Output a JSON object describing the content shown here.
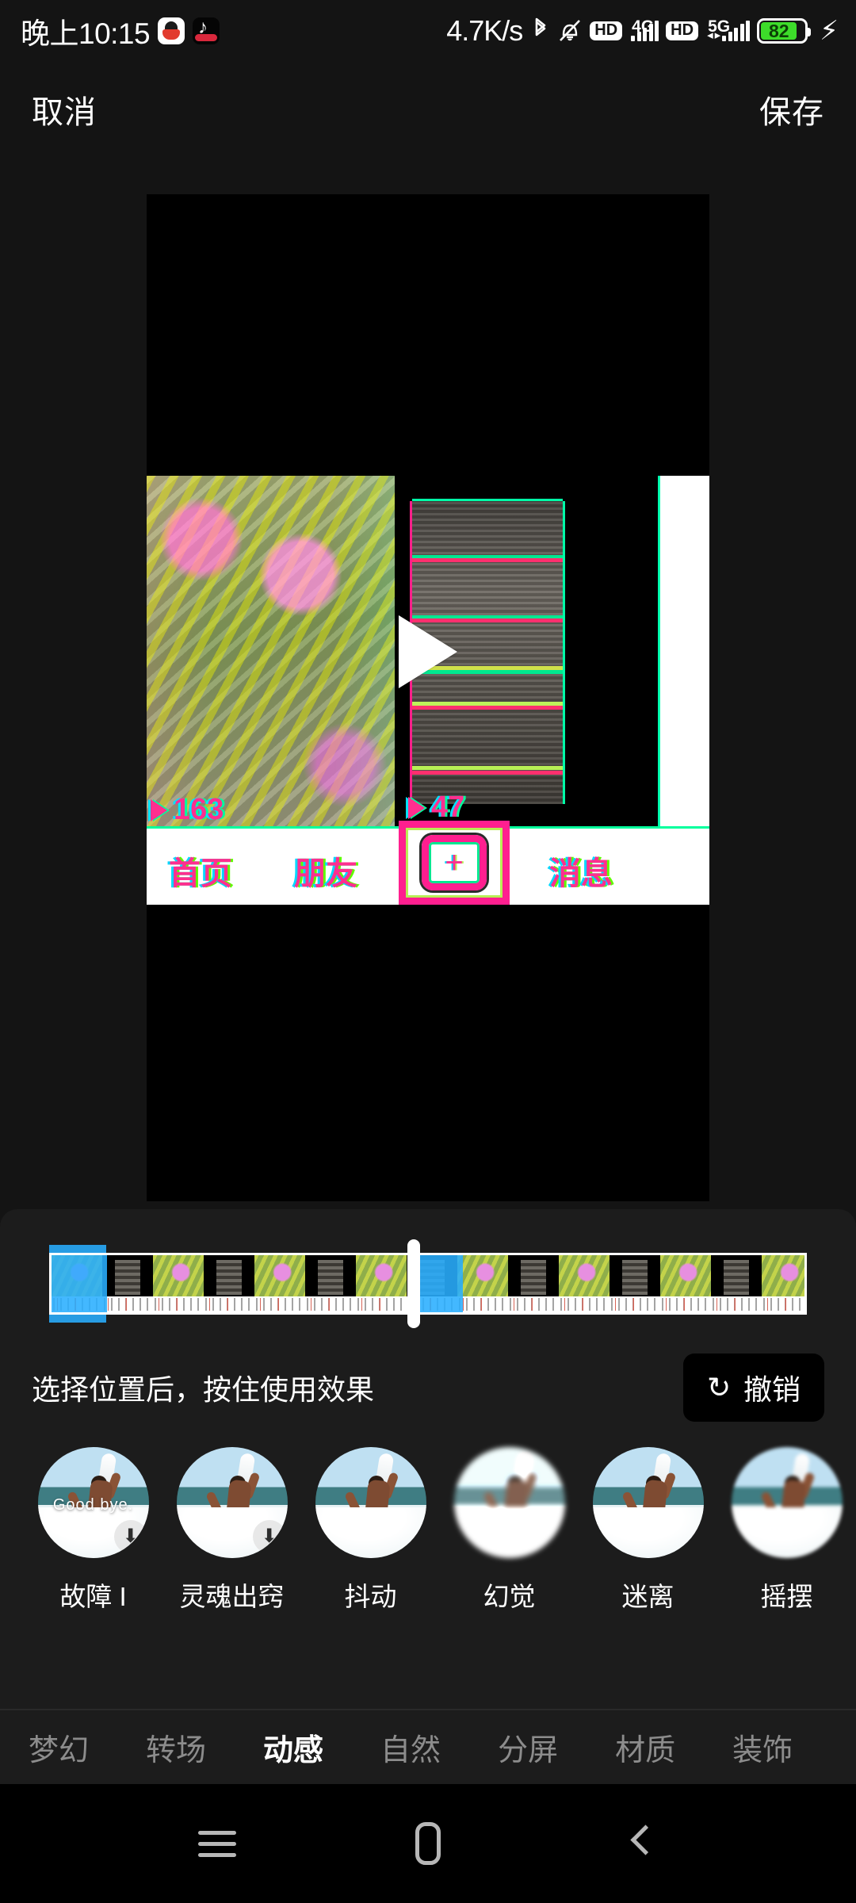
{
  "status_bar": {
    "clock": "晚上10:15",
    "app_icons": [
      "qq-icon",
      "tiktok-icon"
    ],
    "network_speed": "4.7K/s",
    "icons": [
      "bluetooth-icon",
      "mute-icon"
    ],
    "sim1": {
      "hd": "HD",
      "network": "4G",
      "bars": 5
    },
    "sim2": {
      "hd": "HD",
      "network": "5G",
      "bars": 5
    },
    "battery_percent": "82",
    "charging": true,
    "battery_color": "#3ddc2a"
  },
  "topbar": {
    "cancel_label": "取消",
    "save_label": "保存"
  },
  "preview": {
    "play_icon": "play-icon",
    "view_count_left": "163",
    "view_count_right": "47",
    "inner_nav": {
      "home": "首页",
      "friends": "朋友",
      "add": "+",
      "messages": "消息"
    }
  },
  "timeline": {
    "playhead_position_percent": 47,
    "selection_color": "#29aeff",
    "frames": [
      "flora",
      "phone",
      "flora",
      "phone",
      "flora",
      "phone",
      "flora",
      "phone",
      "flora",
      "phone",
      "flora",
      "phone",
      "flora",
      "phone",
      "flora",
      "phone",
      "flora",
      "phone",
      "flora",
      "phone"
    ]
  },
  "hint": {
    "text": "选择位置后，按住使用效果",
    "undo_label": "撤销",
    "undo_icon": "undo-icon"
  },
  "effects": [
    {
      "label": "故障 I",
      "overlay_text": "Good bye.",
      "downloaded": true,
      "style": "normal"
    },
    {
      "label": "灵魂出窍",
      "overlay_text": "",
      "downloaded": true,
      "style": "normal"
    },
    {
      "label": "抖动",
      "overlay_text": "",
      "downloaded": false,
      "style": "normal"
    },
    {
      "label": "幻觉",
      "overlay_text": "",
      "downloaded": false,
      "style": "blurA"
    },
    {
      "label": "迷离",
      "overlay_text": "",
      "downloaded": false,
      "style": "normal"
    },
    {
      "label": "摇摆",
      "overlay_text": "",
      "downloaded": false,
      "style": "blurB"
    }
  ],
  "categories": [
    {
      "label": "梦幻",
      "active": false
    },
    {
      "label": "转场",
      "active": false
    },
    {
      "label": "动感",
      "active": true
    },
    {
      "label": "自然",
      "active": false
    },
    {
      "label": "分屏",
      "active": false
    },
    {
      "label": "材质",
      "active": false
    },
    {
      "label": "装饰",
      "active": false
    }
  ],
  "nav_bar": {
    "recents_icon": "recents-icon",
    "home_icon": "home-icon",
    "back_icon": "back-icon"
  }
}
